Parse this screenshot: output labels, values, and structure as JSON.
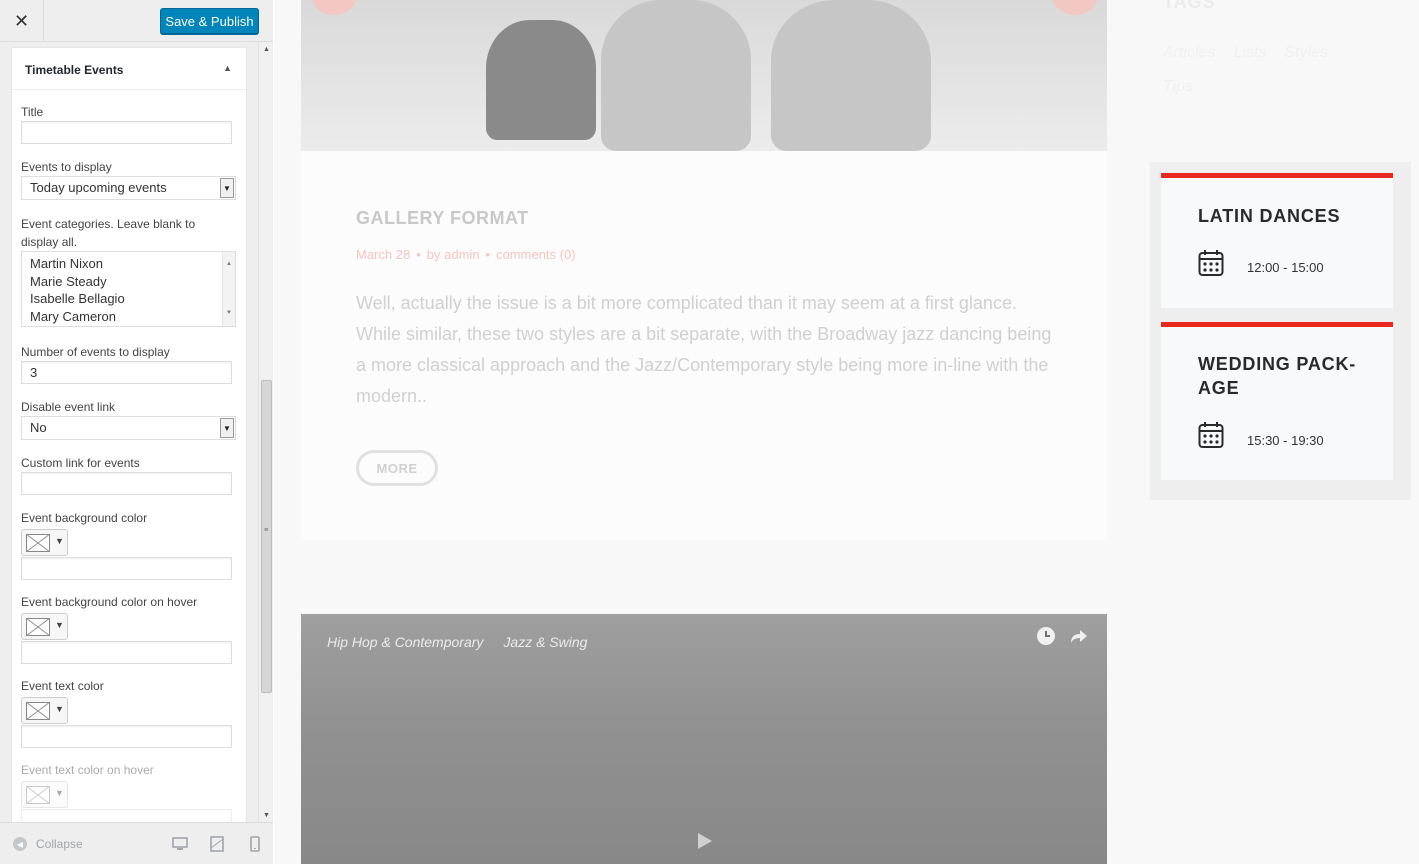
{
  "customizer": {
    "publish_label": "Save & Publish",
    "widget_title": "Timetable Events",
    "fields": {
      "title_label": "Title",
      "title_value": "",
      "events_to_display_label": "Events to display",
      "events_to_display_value": "Today upcoming events",
      "categories_label": "Event categories. Leave blank to display all.",
      "categories": [
        "Martin Nixon",
        "Marie Steady",
        "Isabelle Bellagio",
        "Mary Cameron"
      ],
      "number_label": "Number of events to display",
      "number_value": "3",
      "disable_link_label": "Disable event link",
      "disable_link_value": "No",
      "custom_link_label": "Custom link for events",
      "custom_link_value": "",
      "bg_color_label": "Event background color",
      "bg_hover_label": "Event background color on hover",
      "text_color_label": "Event text color",
      "text_hover_label": "Event text color on hover"
    },
    "footer": {
      "collapse_label": "Collapse"
    }
  },
  "preview": {
    "post": {
      "title": "GALLERY FORMAT",
      "date": "March 28",
      "author": "by admin",
      "comments": "comments (0)",
      "excerpt": "Well, actually the issue is a bit more complicated than it may seem at a first glance. While similar, these two styles are a bit separate, with the Broadway jazz dancing being a more classical approach and the Jazz/Contemporary style being more in-line with the modern..",
      "more_label": "MORE"
    },
    "video": {
      "tags": [
        "Hip Hop & Contemporary",
        "Jazz & Swing"
      ]
    },
    "tags_widget": {
      "title": "TAGS",
      "tags": [
        "Articles",
        "Lists",
        "Styles",
        "Tips"
      ]
    },
    "timetable": {
      "accent": "#e8281e",
      "events": [
        {
          "title": "LATIN DANCES",
          "time": "12:00 - 15:00"
        },
        {
          "title": "WEDDING PACK-AGE",
          "time": "15:30 - 19:30"
        }
      ]
    }
  },
  "colors": {
    "publish_button": "#0085ba",
    "event_accent": "#e8281e"
  }
}
